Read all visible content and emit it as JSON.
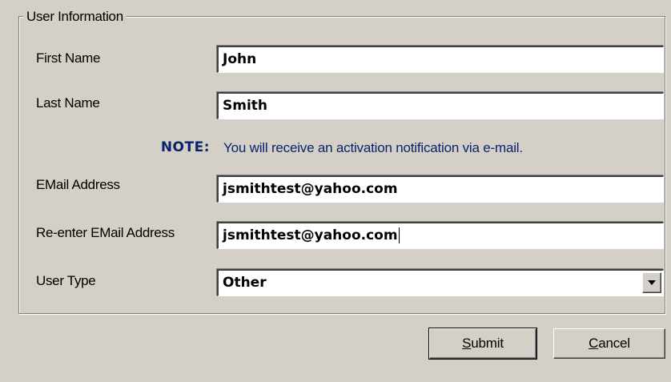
{
  "group": {
    "title": "User Information"
  },
  "fields": {
    "first_name": {
      "label": "First Name",
      "value": "John"
    },
    "last_name": {
      "label": "Last Name",
      "value": "Smith"
    },
    "note": {
      "label": "NOTE:",
      "text": "You will receive an activation notification via e-mail."
    },
    "email": {
      "label": "EMail Address",
      "value": "jsmithtest@yahoo.com"
    },
    "email_confirm": {
      "label": "Re-enter EMail Address",
      "value": "jsmithtest@yahoo.com"
    },
    "user_type": {
      "label": "User Type",
      "value": "Other",
      "icon": "chevron-down-icon"
    }
  },
  "buttons": {
    "submit": {
      "mnemonic": "S",
      "rest": "ubmit"
    },
    "cancel": {
      "mnemonic": "C",
      "rest": "ancel"
    }
  }
}
